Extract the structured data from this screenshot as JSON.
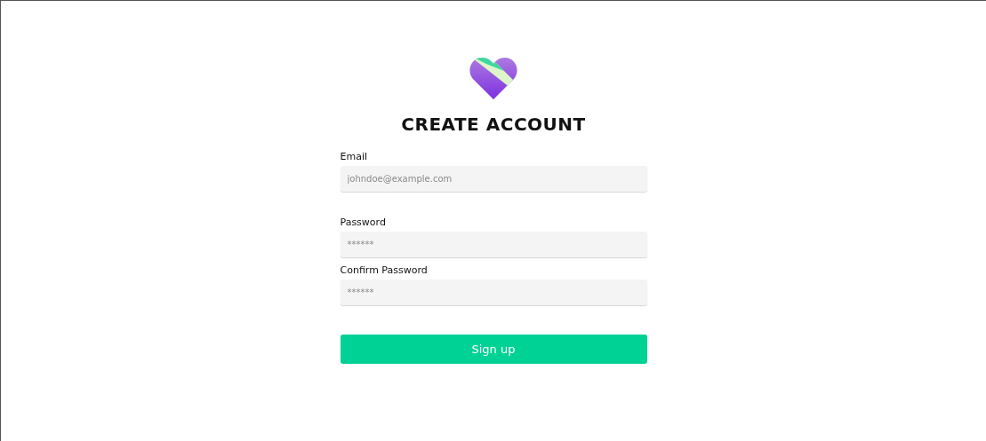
{
  "title": "CREATE ACCOUNT",
  "fields": [
    {
      "label": "Email",
      "placeholder": "johndoe@example.com"
    },
    {
      "label": "Password",
      "placeholder": "******"
    },
    {
      "label": "Confirm Password",
      "placeholder": "******"
    }
  ],
  "submit": "Sign up"
}
